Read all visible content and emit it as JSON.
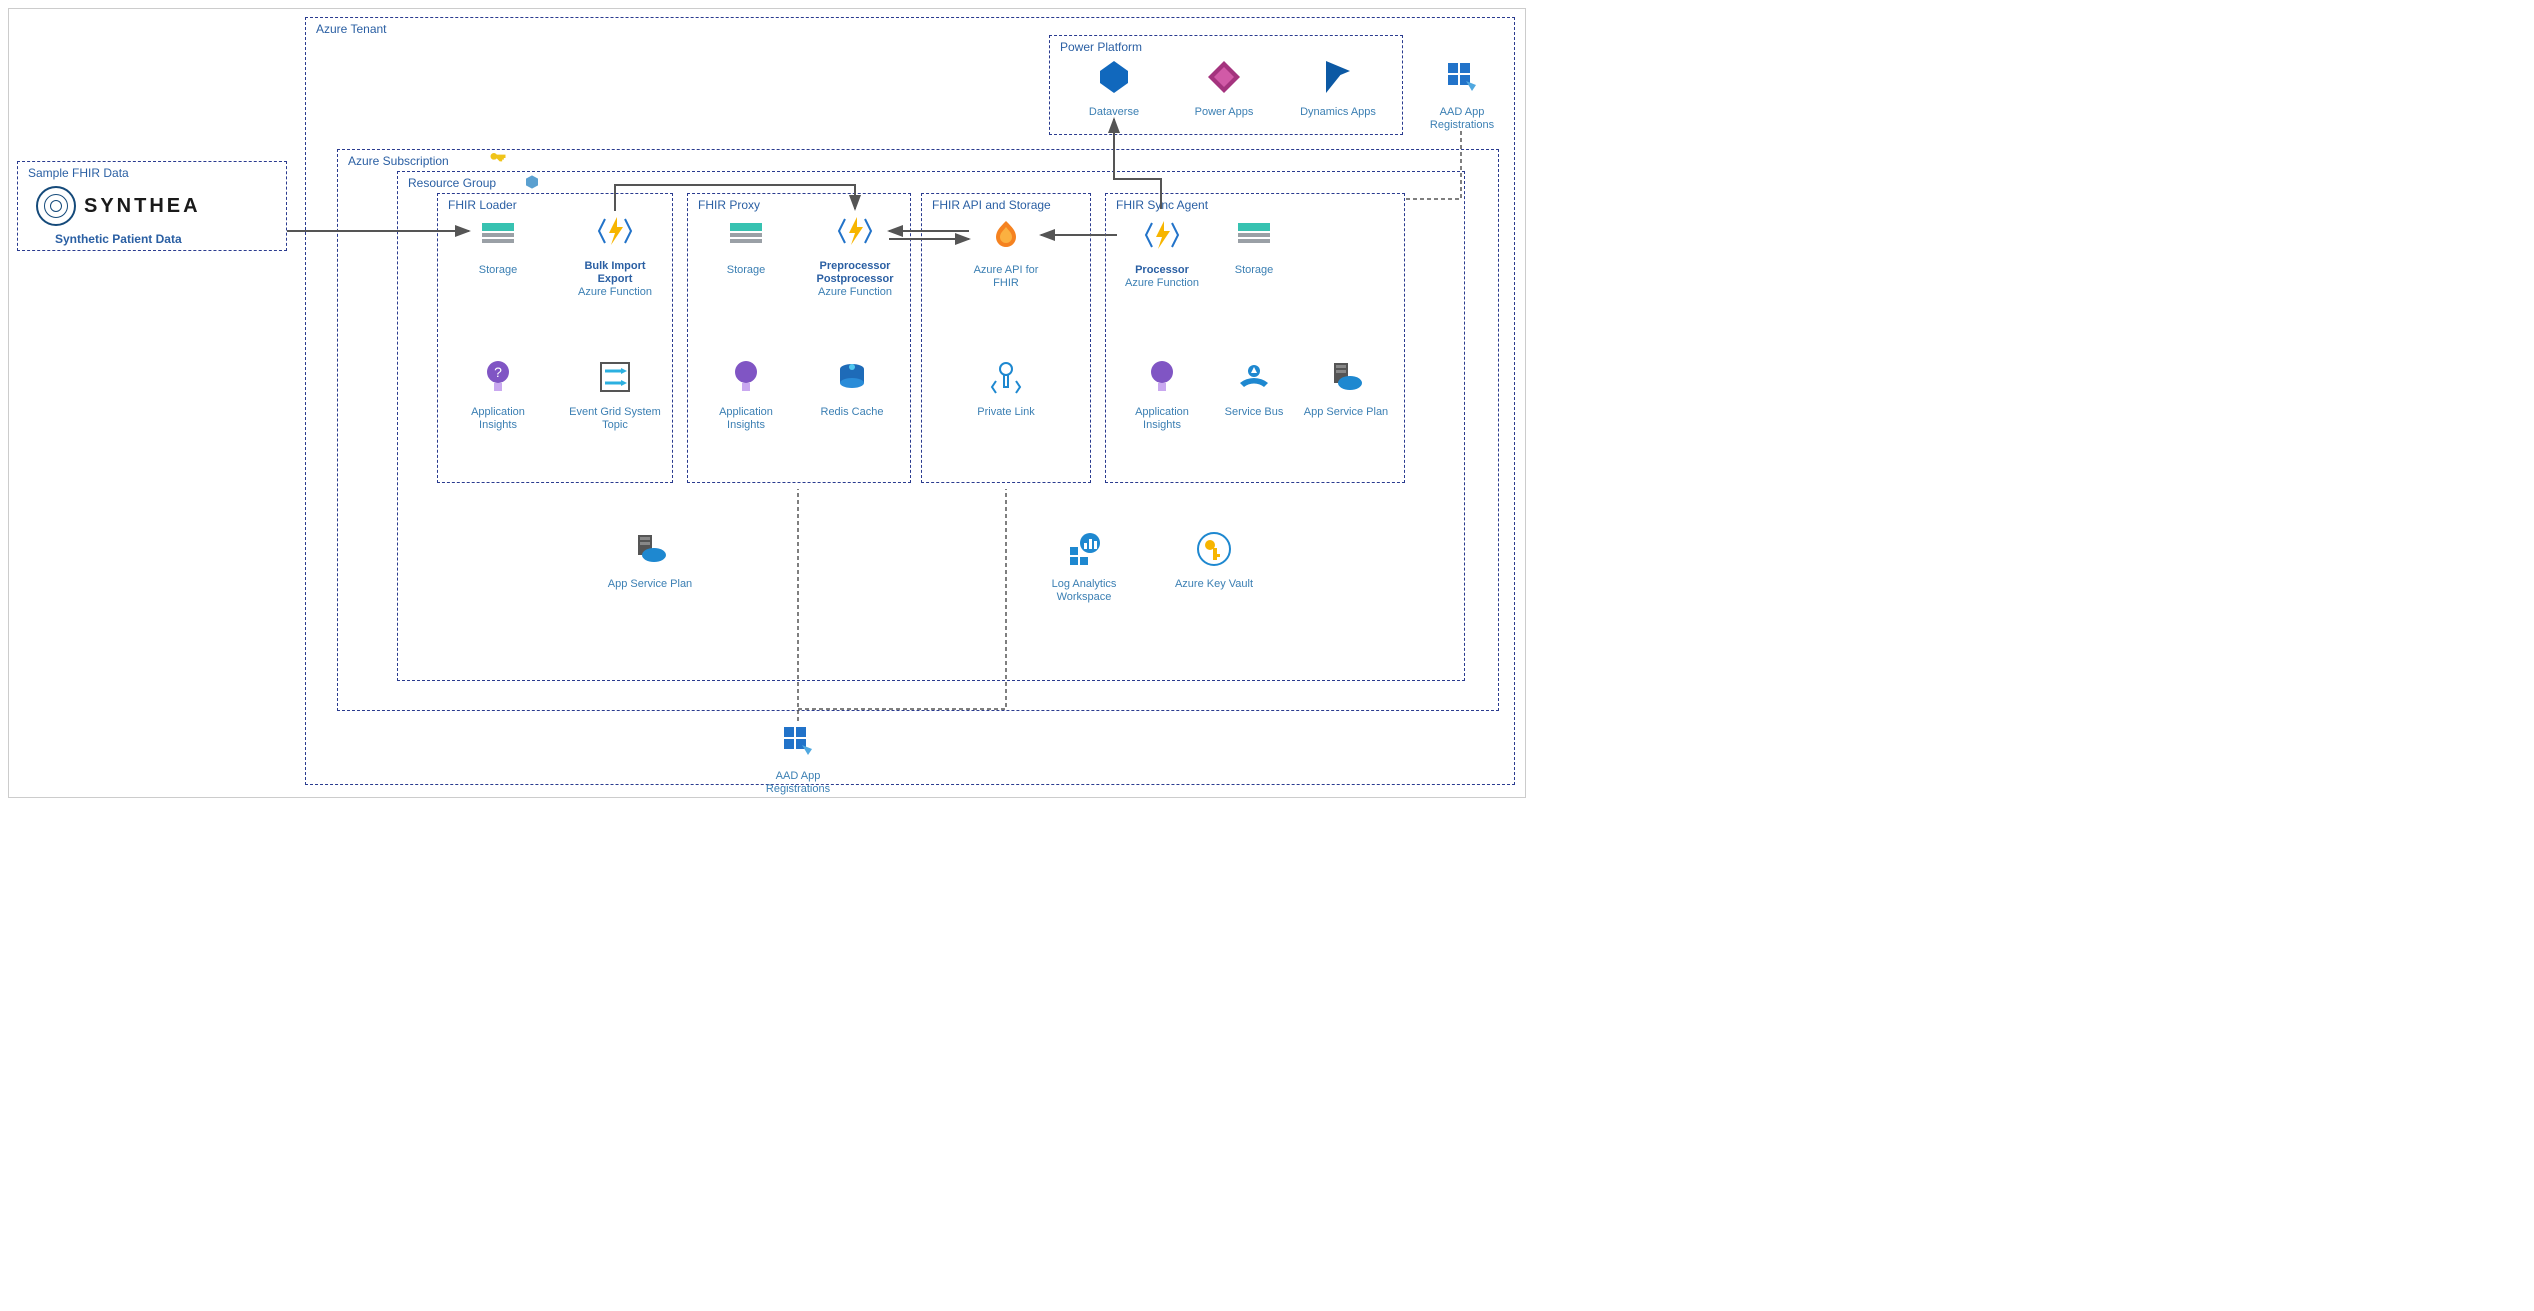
{
  "containers": {
    "sample_fhir": "Sample FHIR Data",
    "azure_tenant": "Azure Tenant",
    "azure_subscription": "Azure Subscription",
    "resource_group": "Resource Group",
    "fhir_loader": "FHIR Loader",
    "fhir_proxy": "FHIR Proxy",
    "fhir_api_storage": "FHIR API and Storage",
    "fhir_sync_agent": "FHIR Sync Agent",
    "power_platform": "Power Platform"
  },
  "synthea": {
    "brand": "SYNTHEA",
    "tagline": "Synthetic Patient Data"
  },
  "nodes": {
    "loader_storage": "Storage",
    "loader_fn_bold1": "Bulk Import",
    "loader_fn_bold2": "Export",
    "loader_fn_sub": "Azure Function",
    "loader_ai": "Application Insights",
    "loader_egt": "Event Grid System Topic",
    "proxy_storage": "Storage",
    "proxy_fn_bold1": "Preprocessor",
    "proxy_fn_bold2": "Postprocessor",
    "proxy_fn_sub": "Azure Function",
    "proxy_ai": "Application Insights",
    "proxy_redis": "Redis Cache",
    "api_fhir": "Azure API for FHIR",
    "api_pl": "Private Link",
    "sync_fn_bold": "Processor",
    "sync_fn_sub": "Azure Function",
    "sync_storage": "Storage",
    "sync_ai": "Application Insights",
    "sync_sb": "Service Bus",
    "sync_asp": "App Service Plan",
    "rg_asp": "App Service Plan",
    "rg_law": "Log Analytics Workspace",
    "rg_kv": "Azure Key Vault",
    "pp_dataverse": "Dataverse",
    "pp_powerapps": "Power Apps",
    "pp_dynamics": "Dynamics Apps",
    "tenant_aad": "AAD App Registrations",
    "bottom_aad": "AAD App Registrations"
  }
}
